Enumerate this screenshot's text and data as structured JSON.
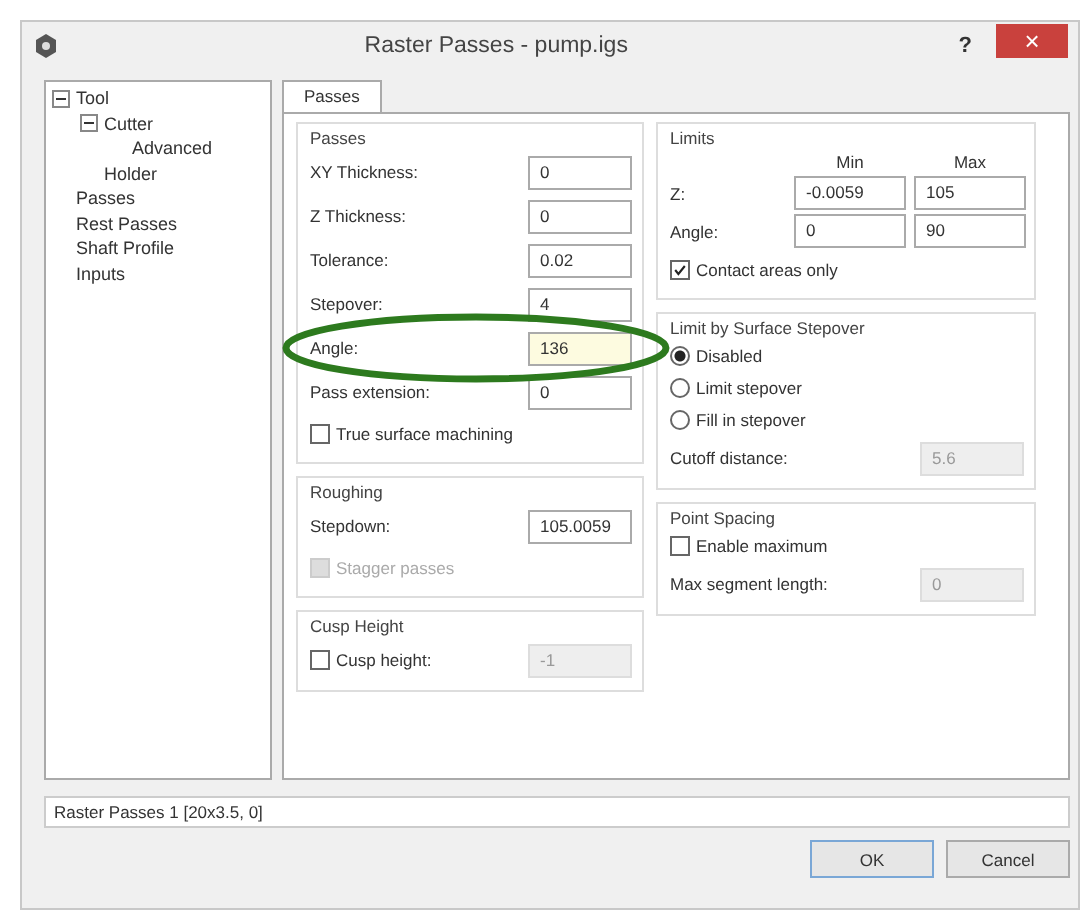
{
  "window": {
    "title": "Raster Passes - pump.igs",
    "help": "?",
    "close": "×"
  },
  "tree": [
    {
      "label": "Tool",
      "expanded": true,
      "children": [
        {
          "label": "Cutter",
          "expanded": true,
          "children": [
            {
              "label": "Advanced"
            }
          ]
        },
        {
          "label": "Holder"
        }
      ]
    },
    {
      "label": "Passes"
    },
    {
      "label": "Rest Passes"
    },
    {
      "label": "Shaft Profile"
    },
    {
      "label": "Inputs"
    }
  ],
  "tabs": [
    {
      "label": "Passes",
      "selected": true
    }
  ],
  "passes": {
    "title": "Passes",
    "fields": [
      {
        "label": "XY Thickness:",
        "value": "0",
        "focused": false
      },
      {
        "label": "Z Thickness:",
        "value": "0",
        "focused": false
      },
      {
        "label": "Tolerance:",
        "value": "0.02",
        "focused": false
      },
      {
        "label": "Stepover:",
        "value": "4",
        "focused": false
      },
      {
        "label": "Angle:",
        "value": "136",
        "focused": true
      },
      {
        "label": "Pass extension:",
        "value": "0",
        "focused": false
      }
    ],
    "checkbox": {
      "label": "True surface machining",
      "checked": false,
      "disabled": false
    }
  },
  "roughing": {
    "title": "Roughing",
    "field": {
      "label": "Stepdown:",
      "value": "105.0059",
      "disabled": false
    },
    "checkbox": {
      "label": "Stagger passes",
      "checked": false,
      "disabled": true
    }
  },
  "cusp_height": {
    "title": "Cusp Height",
    "checkbox": {
      "label": "Cusp height:",
      "checked": false,
      "disabled": false
    },
    "field": {
      "value": "-1",
      "disabled": true
    }
  },
  "limits": {
    "title": "Limits",
    "columns": [
      "Min",
      "Max"
    ],
    "rows": [
      {
        "label": "Z:",
        "min": "-0.0059",
        "max": "105"
      },
      {
        "label": "Angle:",
        "min": "0",
        "max": "90"
      }
    ],
    "checkbox": {
      "label": "Contact areas only",
      "checked": true,
      "disabled": false
    }
  },
  "surface_stepover": {
    "title": "Limit by Surface Stepover",
    "radios": [
      {
        "label": "Disabled",
        "selected": true
      },
      {
        "label": "Limit stepover",
        "selected": false
      },
      {
        "label": "Fill in stepover",
        "selected": false
      }
    ],
    "field": {
      "label": "Cutoff distance:",
      "value": "5.6",
      "disabled": true
    }
  },
  "point_spacing": {
    "title": "Point Spacing",
    "checkbox": {
      "label": "Enable maximum",
      "checked": false,
      "disabled": false
    },
    "field": {
      "label": "Max segment length:",
      "value": "0",
      "disabled": true
    }
  },
  "status": "Raster Passes 1 [20x3.5, 0]",
  "buttons": [
    "OK",
    "Cancel"
  ]
}
